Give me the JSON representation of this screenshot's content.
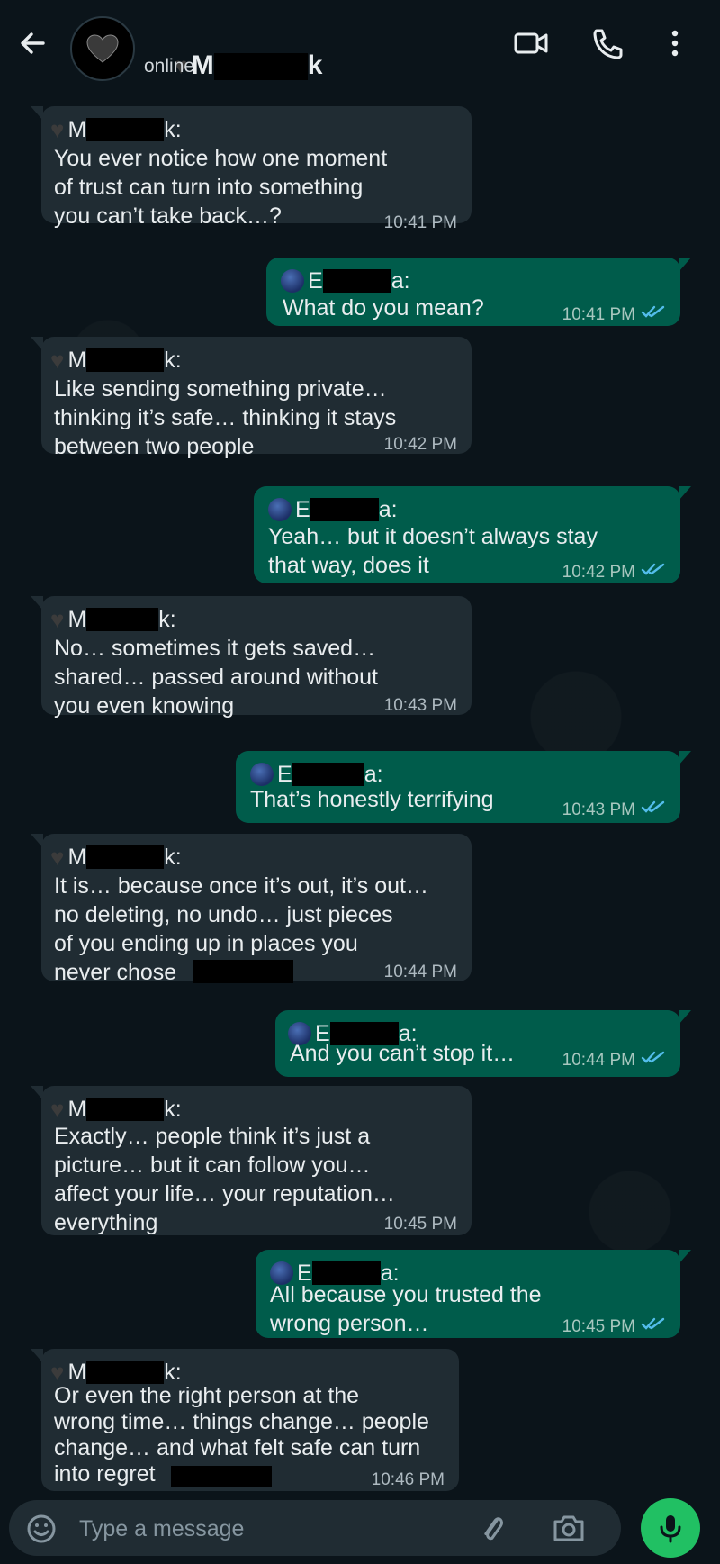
{
  "header": {
    "contact_name_start": "M",
    "contact_name_end": "k",
    "status": "online",
    "icons": [
      "back-arrow-icon",
      "heart-icon",
      "video-call-icon",
      "phone-call-icon",
      "more-options-icon"
    ]
  },
  "messages": [
    {
      "direction": "incoming",
      "sender_start": "M",
      "sender_end": "k:",
      "text": "You ever notice how one moment\nof trust can turn into something\nyou can’t take back…?",
      "time": "10:41 PM"
    },
    {
      "direction": "outgoing",
      "sender_start": "E",
      "sender_end": "a:",
      "text": "What do you mean?",
      "time": "10:41 PM",
      "read": true
    },
    {
      "direction": "incoming",
      "sender_start": "M",
      "sender_end": "k:",
      "text": "Like sending something private…\nthinking it’s safe… thinking it stays\nbetween two people",
      "time": "10:42 PM"
    },
    {
      "direction": "outgoing",
      "sender_start": "E",
      "sender_end": "a:",
      "text": "Yeah… but it doesn’t always stay\nthat way, does it",
      "time": "10:42 PM",
      "read": true
    },
    {
      "direction": "incoming",
      "sender_start": "M",
      "sender_end": "k:",
      "text": "No… sometimes it gets saved…\nshared… passed around without\nyou even knowing",
      "time": "10:43 PM"
    },
    {
      "direction": "outgoing",
      "sender_start": "E",
      "sender_end": "a:",
      "text": "That’s honestly terrifying",
      "time": "10:43 PM",
      "read": true
    },
    {
      "direction": "incoming",
      "sender_start": "M",
      "sender_end": "k:",
      "text": "It is… because once it’s out, it’s out…\nno deleting, no undo… just pieces\nof you ending up in places you\nnever chose",
      "time": "10:44 PM"
    },
    {
      "direction": "outgoing",
      "sender_start": "E",
      "sender_end": "a:",
      "text": "And you can’t stop it…",
      "time": "10:44 PM",
      "read": true
    },
    {
      "direction": "incoming",
      "sender_start": "M",
      "sender_end": "k:",
      "text": "Exactly… people think it’s just a\npicture… but it can follow you…\naffect your life… your reputation…\neverything",
      "time": "10:45 PM"
    },
    {
      "direction": "outgoing",
      "sender_start": "E",
      "sender_end": "a:",
      "text": "All because you trusted the\nwrong person…",
      "time": "10:45 PM",
      "read": true
    },
    {
      "direction": "incoming",
      "sender_start": "M",
      "sender_end": "k:",
      "text": "Or even the right person at the\nwrong time… things change… people\nchange… and what felt safe can turn\ninto regret",
      "time": "10:46 PM"
    }
  ],
  "composer": {
    "placeholder": "Type a message",
    "icons": [
      "emoji-icon",
      "attach-icon",
      "camera-icon",
      "mic-icon"
    ]
  },
  "colors": {
    "background": "#0b141a",
    "incoming_bubble": "#202c33",
    "outgoing_bubble": "#005c4b",
    "read_ticks": "#53bdeb",
    "mic_button": "#21c063"
  }
}
